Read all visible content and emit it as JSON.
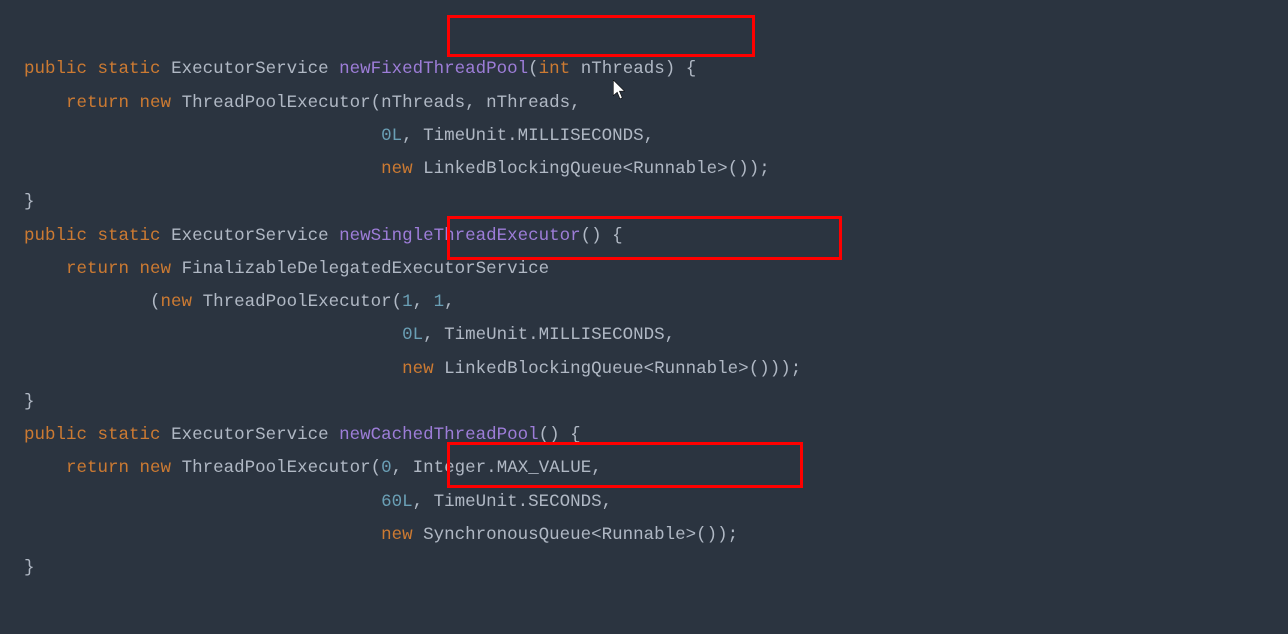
{
  "colors": {
    "background": "#2b3440",
    "keyword": "#cc7a32",
    "identifier": "#b0b8c4",
    "method": "#9d7dd8",
    "number": "#6a9fb5",
    "highlightBox": "#ff0000"
  },
  "highlights": [
    "newFixedThreadPool",
    "newSingleThreadExecutor",
    "newCachedThreadPool"
  ],
  "code": {
    "t01_kw_public": "public",
    "t02_kw_static": "static",
    "t03_type_exec": "ExecutorService",
    "t04_m_newFixed": "newFixedThreadPool",
    "t05_lp": "(",
    "t06_kw_int": "int",
    "t07_p_nThreads": "nThreads",
    "t08_rp_sp_lb": ") {",
    "t09_kw_return": "return",
    "t10_kw_new": "new",
    "t11_type_tpe": "ThreadPoolExecutor",
    "t12_lp": "(",
    "t13_p_nThreads2": "nThreads",
    "t14_comma_sp": ", ",
    "t15_p_nThreads3": "nThreads",
    "t16_comma": ",",
    "t17_num_0L": "0L",
    "t18_comma_sp": ", ",
    "t19_type_timeunit": "TimeUnit",
    "t20_dot": ".",
    "t21_lit_ms": "MILLISECONDS",
    "t22_comma": ",",
    "t23_kw_new": "new",
    "t24_type_lbq": "LinkedBlockingQueue",
    "t25_lt": "<",
    "t26_type_runnable": "Runnable",
    "t27_gt": ">",
    "t28_lprp_semi": "());",
    "t29_rb": "}",
    "t30_kw_public": "public",
    "t31_kw_static": "static",
    "t32_type_exec": "ExecutorService",
    "t33_m_newSingle": "newSingleThreadExecutor",
    "t34_lprp_sp_lb": "() {",
    "t35_kw_return": "return",
    "t36_kw_new": "new",
    "t37_type_fdes": "FinalizableDelegatedExecutorService",
    "t38_lp": "(",
    "t39_kw_new": "new",
    "t40_type_tpe": "ThreadPoolExecutor",
    "t41_lp": "(",
    "t42_num_1": "1",
    "t43_comma_sp": ", ",
    "t44_num_1b": "1",
    "t45_comma": ",",
    "t46_num_0L": "0L",
    "t47_comma_sp": ", ",
    "t48_type_timeunit": "TimeUnit",
    "t49_dot": ".",
    "t50_lit_ms": "MILLISECONDS",
    "t51_comma": ",",
    "t52_kw_new": "new",
    "t53_type_lbq": "LinkedBlockingQueue",
    "t54_lt": "<",
    "t55_type_runnable": "Runnable",
    "t56_gt": ">",
    "t57_lprprp_semi": "()));",
    "t58_rb": "}",
    "t59_kw_public": "public",
    "t60_kw_static": "static",
    "t61_type_exec": "ExecutorService",
    "t62_m_newCached": "newCachedThreadPool",
    "t63_lprp_sp_lb": "() {",
    "t64_kw_return": "return",
    "t65_kw_new": "new",
    "t66_type_tpe": "ThreadPoolExecutor",
    "t67_lp": "(",
    "t68_num_0": "0",
    "t69_comma_sp": ", ",
    "t70_type_integer": "Integer",
    "t71_dot": ".",
    "t72_lit_maxval": "MAX_VALUE",
    "t73_comma": ",",
    "t74_num_60L": "60L",
    "t75_comma_sp": ", ",
    "t76_type_timeunit": "TimeUnit",
    "t77_dot": ".",
    "t78_lit_sec": "SECONDS",
    "t79_comma": ",",
    "t80_kw_new": "new",
    "t81_type_sq": "SynchronousQueue",
    "t82_lt": "<",
    "t83_type_runnable": "Runnable",
    "t84_gt": ">",
    "t85_lprp_semi": "());",
    "t86_rb": "}"
  }
}
